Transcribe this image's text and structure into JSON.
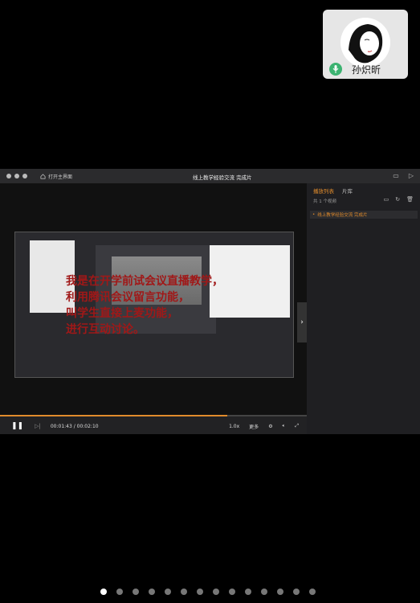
{
  "participant": {
    "name": "孙炽昕",
    "mic_icon": "mic-icon"
  },
  "window": {
    "home_label": "打开主界面",
    "title": "线上教学经验交流 完成片"
  },
  "overlay_text": [
    "我是在开学前试会议直播教学，",
    "利用腾讯会议留言功能，",
    "叫学生直接上麦功能，",
    "进行互动讨论。"
  ],
  "controls": {
    "time": "00:01:43 / 00:02:10",
    "speed": "1.0x",
    "more": "更多",
    "progress": 0.74
  },
  "sidebar": {
    "tabs": [
      "播放列表",
      "片库"
    ],
    "count": "共 1 个视频",
    "items": [
      "线上教学经验交流 完成片"
    ]
  },
  "page_dots": {
    "total": 14,
    "active": 0
  }
}
